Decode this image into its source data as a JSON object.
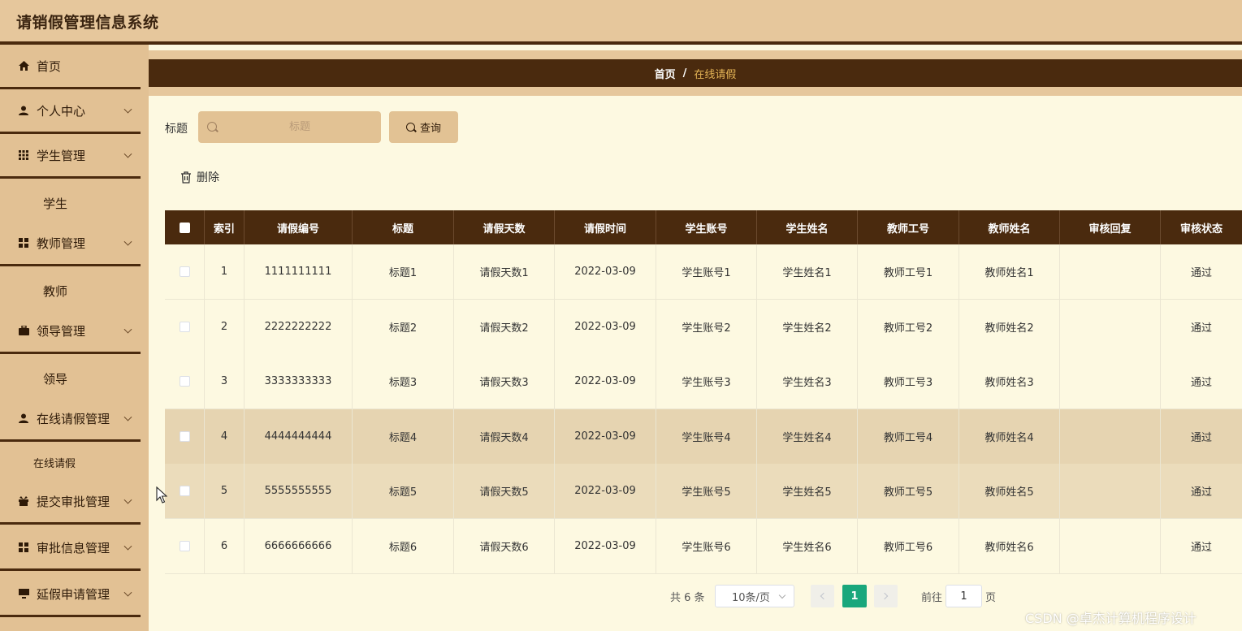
{
  "app": {
    "title": "请销假管理信息系统"
  },
  "sidebar": {
    "items": [
      {
        "label": "首页",
        "icon": "home-icon",
        "expandable": false
      },
      {
        "label": "个人中心",
        "icon": "user-icon",
        "expandable": true
      },
      {
        "label": "学生管理",
        "icon": "grid-icon",
        "expandable": true
      },
      {
        "label": "学生",
        "sub": true
      },
      {
        "label": "教师管理",
        "icon": "grid-icon",
        "expandable": true
      },
      {
        "label": "教师",
        "sub": true
      },
      {
        "label": "领导管理",
        "icon": "briefcase-icon",
        "expandable": true
      },
      {
        "label": "领导",
        "sub": true
      },
      {
        "label": "在线请假管理",
        "icon": "user-icon",
        "expandable": true
      },
      {
        "label": "在线请假",
        "sub": true
      },
      {
        "label": "提交审批管理",
        "icon": "gift-icon",
        "expandable": true
      },
      {
        "label": "审批信息管理",
        "icon": "grid-icon",
        "expandable": true
      },
      {
        "label": "延假申请管理",
        "icon": "monitor-icon",
        "expandable": true
      }
    ]
  },
  "breadcrumb": {
    "home": "首页",
    "separator": "/",
    "current": "在线请假"
  },
  "search": {
    "label": "标题",
    "placeholder": "标题",
    "value": "",
    "button_label": "查询"
  },
  "toolbar": {
    "delete_label": "删除"
  },
  "table": {
    "columns": [
      "索引",
      "请假编号",
      "标题",
      "请假天数",
      "请假时间",
      "学生账号",
      "学生姓名",
      "教师工号",
      "教师姓名",
      "审核回复",
      "审核状态"
    ],
    "rows": [
      [
        "1",
        "1111111111",
        "标题1",
        "请假天数1",
        "2022-03-09",
        "学生账号1",
        "学生姓名1",
        "教师工号1",
        "教师姓名1",
        "",
        "通过"
      ],
      [
        "2",
        "2222222222",
        "标题2",
        "请假天数2",
        "2022-03-09",
        "学生账号2",
        "学生姓名2",
        "教师工号2",
        "教师姓名2",
        "",
        "通过"
      ],
      [
        "3",
        "3333333333",
        "标题3",
        "请假天数3",
        "2022-03-09",
        "学生账号3",
        "学生姓名3",
        "教师工号3",
        "教师姓名3",
        "",
        "通过"
      ],
      [
        "4",
        "4444444444",
        "标题4",
        "请假天数4",
        "2022-03-09",
        "学生账号4",
        "学生姓名4",
        "教师工号4",
        "教师姓名4",
        "",
        "通过"
      ],
      [
        "5",
        "5555555555",
        "标题5",
        "请假天数5",
        "2022-03-09",
        "学生账号5",
        "学生姓名5",
        "教师工号5",
        "教师姓名5",
        "",
        "通过"
      ],
      [
        "6",
        "6666666666",
        "标题6",
        "请假天数6",
        "2022-03-09",
        "学生账号6",
        "学生姓名6",
        "教师工号6",
        "教师姓名6",
        "",
        "通过"
      ]
    ]
  },
  "pagination": {
    "total_text": "共 6 条",
    "page_size": "10条/页",
    "current_page": "1",
    "goto_label": "前往",
    "goto_value": "1",
    "goto_suffix": "页"
  },
  "watermark": "CSDN @卓杰计算机程序设计",
  "colors": {
    "header_bg": "#e6c79c",
    "dark_brown": "#4a2a0e",
    "content_bg": "#fdf9e1",
    "accent_gold": "#e3b355",
    "page_active": "#19a77c"
  }
}
